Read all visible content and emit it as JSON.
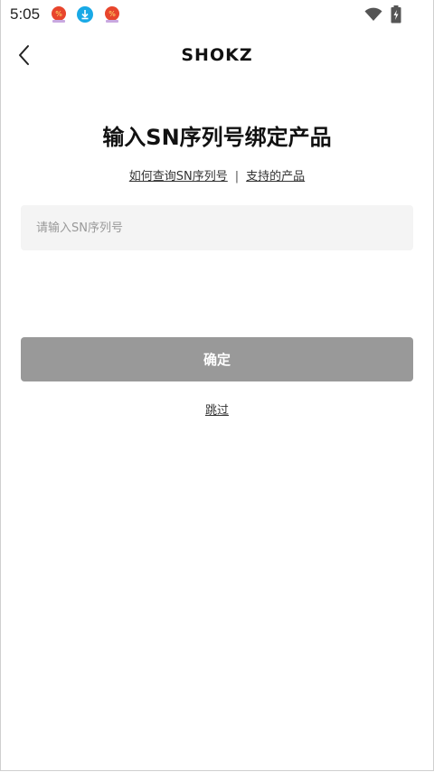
{
  "status_bar": {
    "time": "5:05",
    "notifications": [
      "app-badge-icon",
      "download-icon",
      "app-badge-icon"
    ],
    "wifi_icon": "wifi-icon",
    "battery_icon": "battery-charging-icon"
  },
  "header": {
    "back_icon": "chevron-left-icon",
    "logo": "SHOKZ"
  },
  "main": {
    "title": "输入SN序列号绑定产品",
    "link_query": "如何查询SN序列号",
    "separator": "|",
    "link_supported": "支持的产品",
    "input_placeholder": "请输入SN序列号",
    "input_value": "",
    "confirm_label": "确定",
    "skip_label": "跳过"
  },
  "colors": {
    "confirm_button": "#999999",
    "input_background": "#f4f4f4",
    "text_primary": "#111111"
  }
}
